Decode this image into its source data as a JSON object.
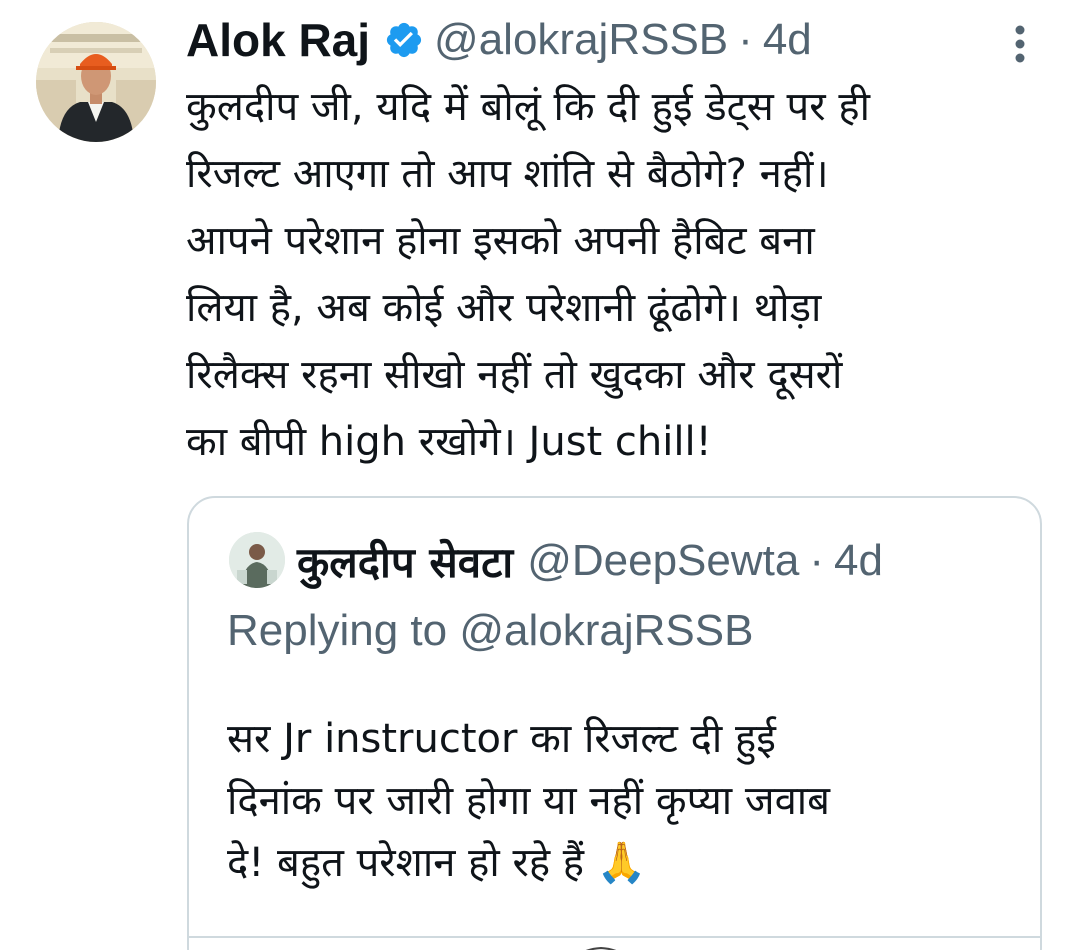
{
  "tweet": {
    "display_name": "Alok Raj",
    "handle": "@alokrajRSSB",
    "separator": "·",
    "time": "4d",
    "text": "कुलदीप जी, यदि में बोलूं कि दी हुई डेट्स पर ही\nरिजल्ट आएगा तो आप शांति से बैठोगे? नहीं।\nआपने परेशान होना इसको अपनी हैबिट बना\nलिया है, अब कोई और परेशानी ढूंढोगे। थोड़ा\nरिलैक्स रहना सीखो नहीं तो खुदका और दूसरों\nका बीपी high रखोगे। Just chill!",
    "icons": {
      "avatar": "profile-photo",
      "verified": "verified-badge-icon",
      "more": "more-vertical-icon"
    }
  },
  "quoted_tweet": {
    "display_name": "कुलदीप सेवटा",
    "handle": "@DeepSewta",
    "separator": "·",
    "time": "4d",
    "replying_to": "Replying to @alokrajRSSB",
    "text": "सर Jr instructor का रिजल्ट दी हुई\nदिनांक पर जारी होगा या नहीं कृप्या जवाब\nदे! बहुत परेशान हो रहे हैं 🙏"
  },
  "colors": {
    "text_primary": "#0f1419",
    "text_secondary": "#536471",
    "verified_blue": "#1d9bf0",
    "border": "#cfd9de"
  }
}
